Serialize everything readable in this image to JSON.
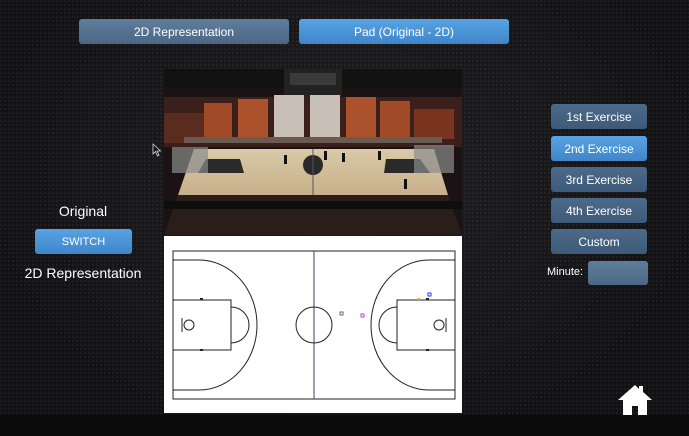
{
  "tabs": {
    "representation_2d": "2D Representation",
    "pad_original_2d": "Pad (Original - 2D)"
  },
  "left_panel": {
    "original_label": "Original",
    "switch_label": "SWITCH",
    "representation_label": "2D Representation"
  },
  "exercises": {
    "ex1": "1st Exercise",
    "ex2": "2nd Exercise",
    "ex3": "3rd Exercise",
    "ex4": "4th Exercise",
    "custom": "Custom"
  },
  "minute": {
    "label": "Minute:",
    "value": ""
  },
  "colors": {
    "active_button": "#4a94d6",
    "inactive_button": "#566f8d",
    "background": "#141416"
  },
  "icons": {
    "home": "home-icon",
    "cursor": "cursor-arrow-icon"
  }
}
